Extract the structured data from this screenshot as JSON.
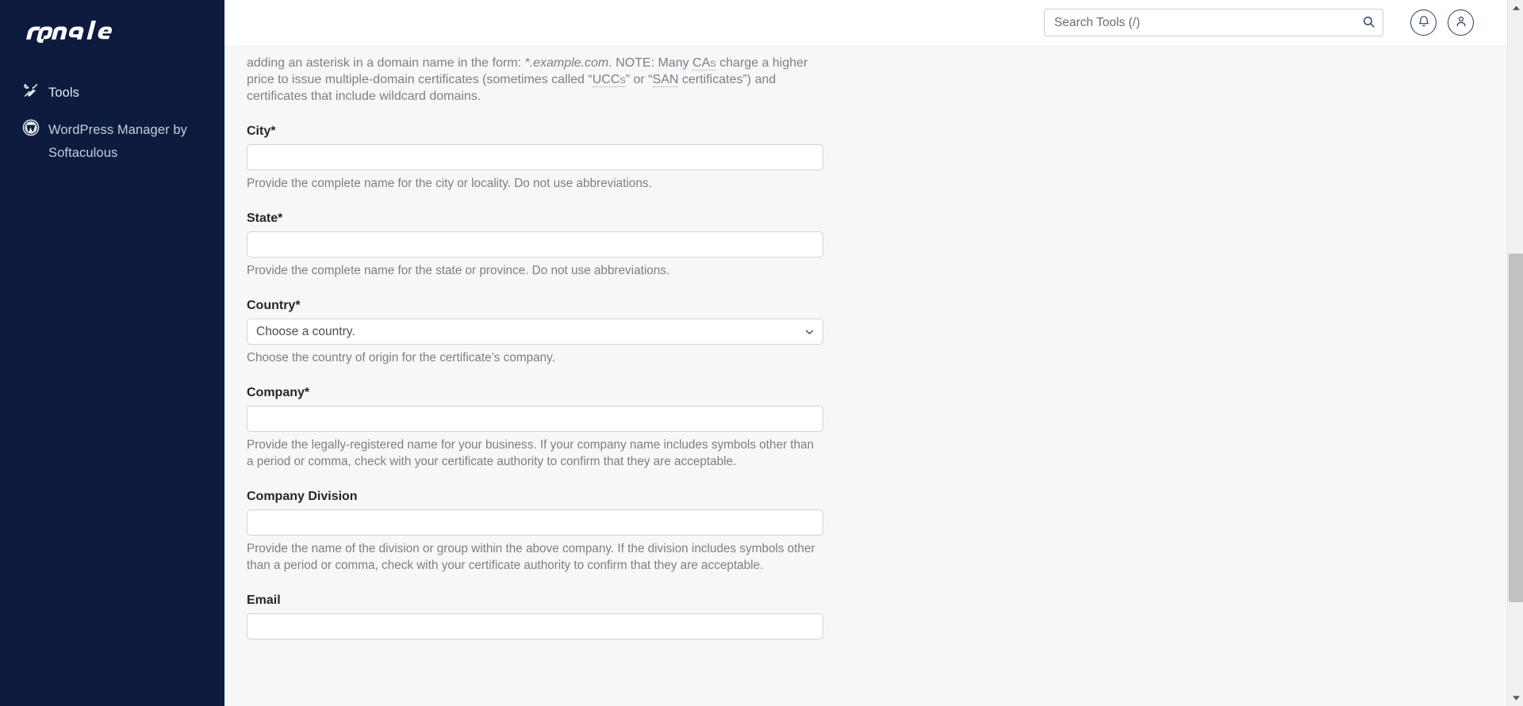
{
  "sidebar": {
    "brand": "cPanel",
    "items": [
      {
        "label": "Tools",
        "icon": "tools-icon"
      },
      {
        "label": "WordPress Manager by Softaculous",
        "icon": "wordpress-icon"
      }
    ]
  },
  "header": {
    "search": {
      "placeholder": "Search Tools (/)",
      "value": "",
      "icon": "search-icon"
    },
    "notifications_icon": "bell-icon",
    "user_icon": "user-icon"
  },
  "content": {
    "intro": {
      "part1": "adding an asterisk in a domain name in the form: ",
      "example": "*.example.com",
      "part2": ". NOTE: Many ",
      "abbr1": "CAs",
      "part3": " charge a higher price to issue multiple-domain certificates (sometimes called “",
      "abbr2": "UCCs",
      "part4": "” or “",
      "abbr3": "SAN",
      "part5": " certificates”) and certificates that include wildcard domains."
    },
    "fields": [
      {
        "label": "City*",
        "value": "",
        "help": "Provide the complete name for the city or locality. Do not use abbreviations."
      },
      {
        "label": "State*",
        "value": "",
        "help": "Provide the complete name for the state or province. Do not use abbreviations."
      },
      {
        "label": "Country*",
        "selected": "Choose a country.",
        "help": "Choose the country of origin for the certificate’s company."
      },
      {
        "label": "Company*",
        "value": "",
        "help": "Provide the legally-registered name for your business. If your company name includes symbols other than a period or comma, check with your certificate authority to confirm that they are acceptable."
      },
      {
        "label": "Company Division",
        "value": "",
        "help": "Provide the name of the division or group within the above company. If the division includes symbols other than a period or comma, check with your certificate authority to confirm that they are acceptable."
      },
      {
        "label": "Email",
        "value": "",
        "help": ""
      }
    ]
  },
  "colors": {
    "sidebar_bg": "#0d1b3e",
    "content_bg": "#f7f7f7",
    "label_text": "#242628",
    "help_text": "#7b7f87",
    "input_border": "#cfd2d6",
    "accent": "#2b3a60"
  }
}
